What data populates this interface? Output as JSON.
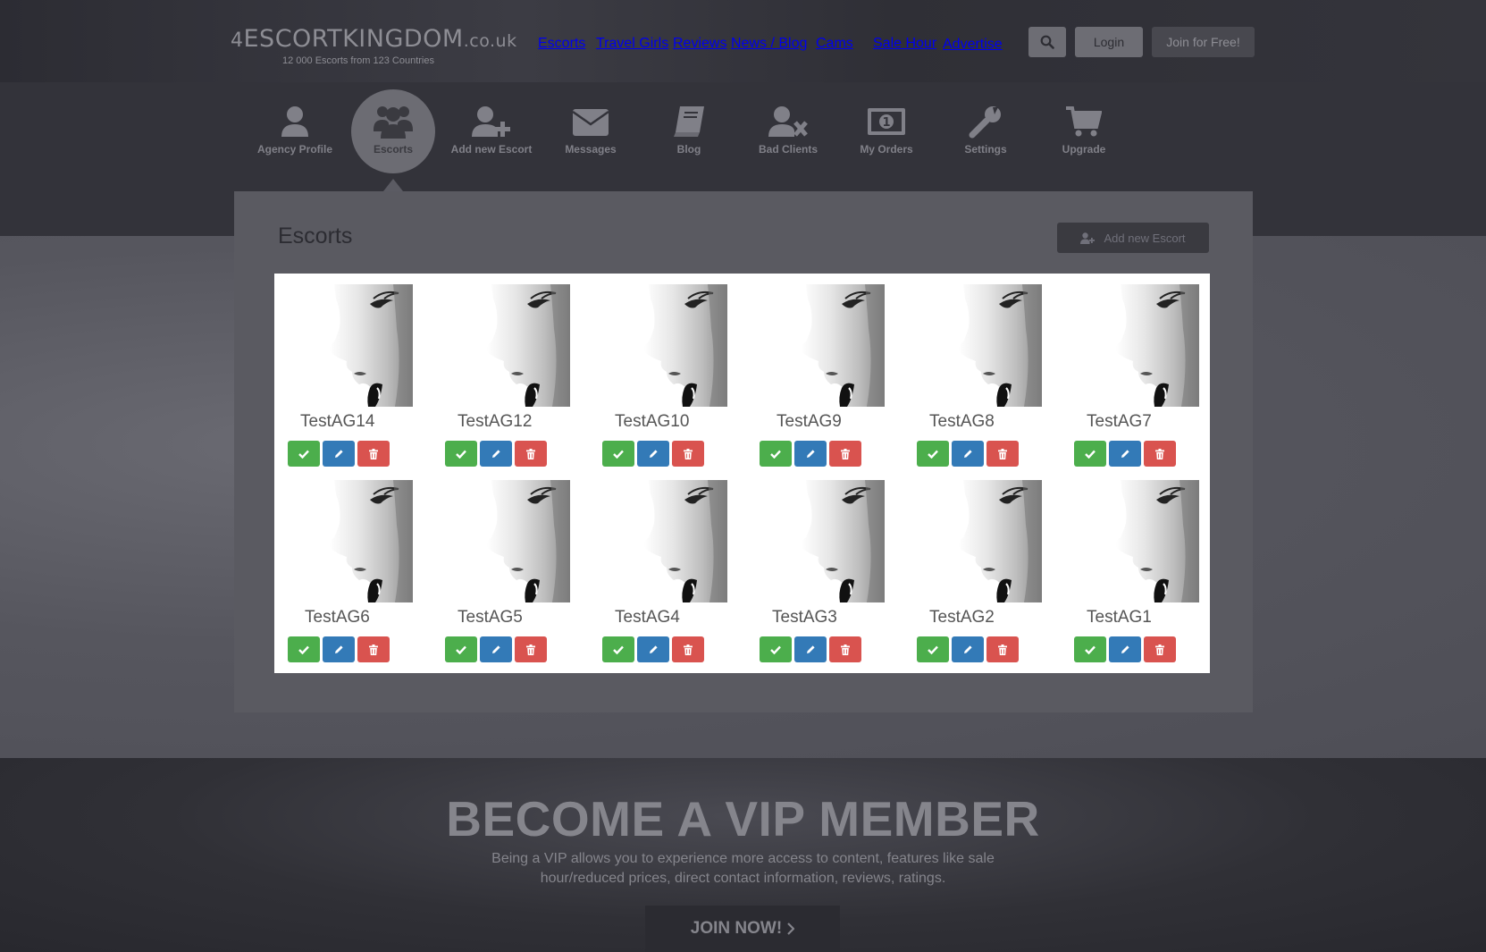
{
  "header": {
    "logo_main": "ESCORTKINGDOM",
    "logo_tld": ".co.uk",
    "logo_sub": "12 000 Escorts from 123 Countries",
    "nav": [
      "Escorts",
      "Travel Girls",
      "Reviews",
      "News / Blog",
      "Cams",
      "Sale Hour",
      "Advertise"
    ],
    "login_label": "Login",
    "join_label": "Join for Free!",
    "search_icon": "search-icon"
  },
  "dashnav": [
    {
      "label": "Agency Profile",
      "icon": "user-icon"
    },
    {
      "label": "Escorts",
      "icon": "users-icon",
      "active": true
    },
    {
      "label": "Add new Escort",
      "icon": "user-plus-icon"
    },
    {
      "label": "Messages",
      "icon": "envelope-icon"
    },
    {
      "label": "Blog",
      "icon": "book-icon"
    },
    {
      "label": "Bad Clients",
      "icon": "user-times-icon"
    },
    {
      "label": "My Orders",
      "icon": "money-icon"
    },
    {
      "label": "Settings",
      "icon": "wrench-icon"
    },
    {
      "label": "Upgrade",
      "icon": "cart-icon"
    }
  ],
  "panel": {
    "title": "Escorts",
    "add_button": "Add new Escort"
  },
  "escorts": [
    "TestAG14",
    "TestAG12",
    "TestAG10",
    "TestAG9",
    "TestAG8",
    "TestAG7",
    "TestAG6",
    "TestAG5",
    "TestAG4",
    "TestAG3",
    "TestAG2",
    "TestAG1"
  ],
  "vip": {
    "title": "BECOME A VIP MEMBER",
    "text": "Being a VIP allows you to experience more access to content, features like sale hour/reduced prices, direct contact information, reviews, ratings.",
    "join": "JOIN NOW!"
  },
  "colors": {
    "approve": "#4cae4c",
    "edit": "#337ab7",
    "delete": "#d9534f"
  }
}
